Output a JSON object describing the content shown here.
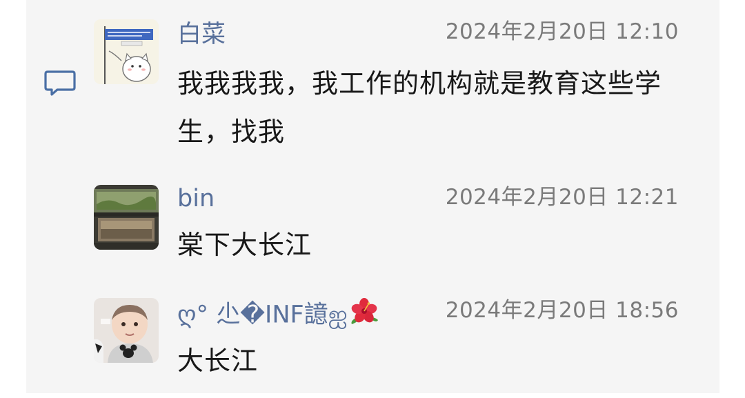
{
  "messages": [
    {
      "name": "白菜",
      "time": "2024年2月20日 12:10",
      "text": "我我我我，我工作的机构就是教育这些学生，找我",
      "avatar": "cat-sign-avatar"
    },
    {
      "name": "bin",
      "time": "2024年2月20日 12:21",
      "text": "棠下大长江",
      "avatar": "building-photo-avatar"
    },
    {
      "name": "ღ° 尐�INF譩ஐ",
      "time": "2024年2月20日 18:56",
      "text": "大长江",
      "avatar": "baby-photo-avatar"
    }
  ],
  "icons": {
    "reply": "comment-icon",
    "flower": "hibiscus-icon"
  },
  "colors": {
    "name": "#58709b",
    "time": "#7a7a7a",
    "text": "#181818",
    "background": "#f5f5f5",
    "reply_icon": "#4a6fa5"
  }
}
